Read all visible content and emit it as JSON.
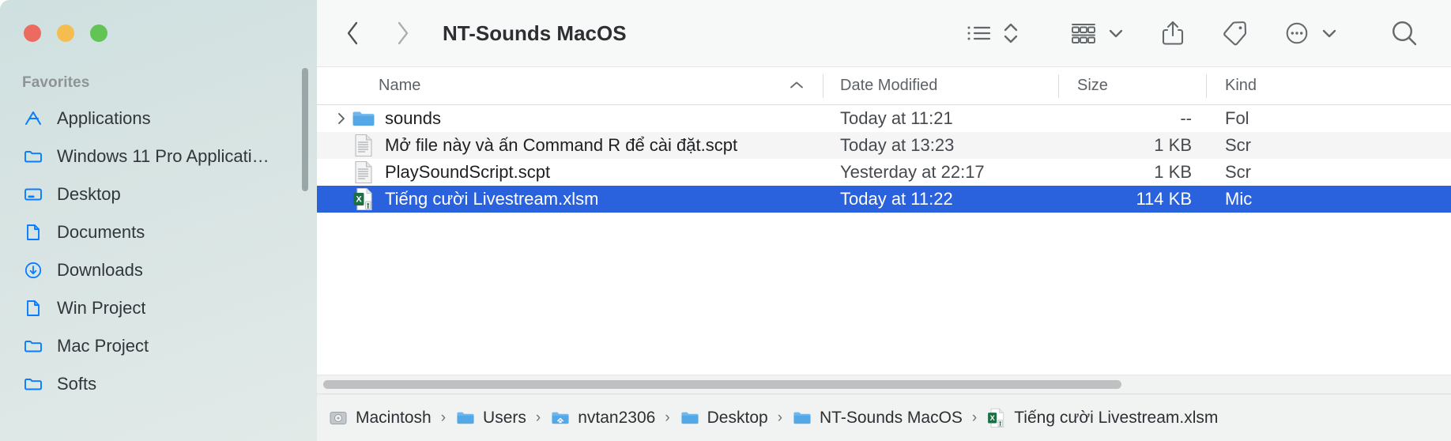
{
  "window": {
    "traffic_lights": [
      {
        "name": "close",
        "color": "#ed6a5e"
      },
      {
        "name": "minimize",
        "color": "#f5bd4f"
      },
      {
        "name": "zoom",
        "color": "#61c454"
      }
    ]
  },
  "sidebar": {
    "section_title": "Favorites",
    "items": [
      {
        "label": "Applications",
        "icon": "applications-icon"
      },
      {
        "label": "Windows 11 Pro Applicati…",
        "icon": "folder-icon"
      },
      {
        "label": "Desktop",
        "icon": "desktop-icon"
      },
      {
        "label": "Documents",
        "icon": "document-icon"
      },
      {
        "label": "Downloads",
        "icon": "downloads-icon"
      },
      {
        "label": "Win Project",
        "icon": "document-icon"
      },
      {
        "label": "Mac Project",
        "icon": "folder-icon"
      },
      {
        "label": "Softs",
        "icon": "folder-icon"
      }
    ]
  },
  "toolbar": {
    "back_label": "Back",
    "forward_label": "Forward",
    "title": "NT-Sounds MacOS",
    "buttons": [
      {
        "name": "view-as-list-icon",
        "label": "View as List"
      },
      {
        "name": "sort-chevrons-icon",
        "label": "Sort"
      },
      {
        "name": "group-items-icon",
        "label": "Group"
      },
      {
        "name": "chevron-down-icon",
        "label": "Group options"
      },
      {
        "name": "share-icon",
        "label": "Share"
      },
      {
        "name": "tag-icon",
        "label": "Tags"
      },
      {
        "name": "more-ellipsis-icon",
        "label": "More"
      },
      {
        "name": "chevron-down-icon",
        "label": "More options"
      },
      {
        "name": "search-icon",
        "label": "Search"
      }
    ]
  },
  "columns": {
    "name": "Name",
    "date_modified": "Date Modified",
    "size": "Size",
    "kind": "Kind",
    "sort_direction": "ascending",
    "sorted_by": "Name"
  },
  "files": [
    {
      "name": "sounds",
      "date_modified": "Today at 11:21",
      "size": "--",
      "kind": "Fol",
      "icon": "folder-icon",
      "has_disclosure": true,
      "selected": false
    },
    {
      "name": "Mở file này và ấn Command R để cài đặt.scpt",
      "date_modified": "Today at 13:23",
      "size": "1 KB",
      "kind": "Scr",
      "icon": "script-icon",
      "has_disclosure": false,
      "selected": false
    },
    {
      "name": "PlaySoundScript.scpt",
      "date_modified": "Yesterday at 22:17",
      "size": "1 KB",
      "kind": "Scr",
      "icon": "script-icon",
      "has_disclosure": false,
      "selected": false
    },
    {
      "name": "Tiếng cười Livestream.xlsm",
      "date_modified": "Today at 11:22",
      "size": "114 KB",
      "kind": "Mic",
      "icon": "excel-icon",
      "has_disclosure": false,
      "selected": true
    }
  ],
  "pathbar": {
    "separator": "›",
    "crumbs": [
      {
        "label": "Macintosh",
        "icon": "harddisk-icon"
      },
      {
        "label": "Users",
        "icon": "folder-icon"
      },
      {
        "label": "nvtan2306",
        "icon": "home-icon"
      },
      {
        "label": "Desktop",
        "icon": "folder-icon"
      },
      {
        "label": "NT-Sounds MacOS",
        "icon": "folder-icon"
      },
      {
        "label": "Tiếng cười Livestream.xlsm",
        "icon": "excel-icon"
      }
    ]
  },
  "colors": {
    "selection_blue": "#2a61dd",
    "sidebar_accent": "#0a7cff",
    "excel_green": "#1d7044"
  }
}
